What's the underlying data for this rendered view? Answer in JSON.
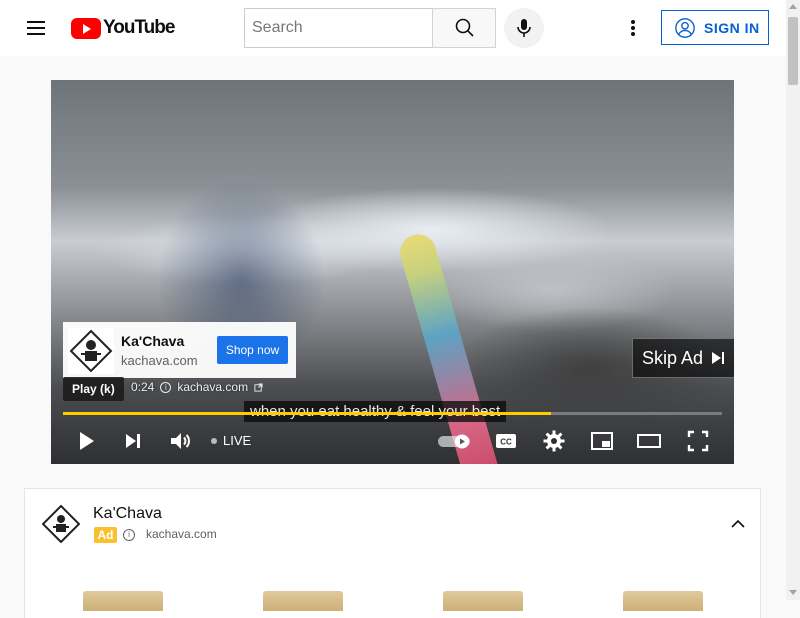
{
  "header": {
    "logo_text": "YouTube",
    "search_placeholder": "Search",
    "sign_in_label": "SIGN IN"
  },
  "player": {
    "ad_card": {
      "advertiser": "Ka'Chava",
      "domain": "kachava.com",
      "cta_label": "Shop now"
    },
    "skip_ad_label": "Skip Ad",
    "tooltip_label": "Play (k)",
    "ad_time": "0:24",
    "ad_domain": "kachava.com",
    "caption_text": "when you eat healthy & feel your best",
    "progress_fraction": 0.74,
    "live_label": "LIVE",
    "progress_color": "#ffcc00"
  },
  "companion": {
    "advertiser": "Ka'Chava",
    "ad_badge": "Ad",
    "domain": "kachava.com"
  },
  "colors": {
    "brand_red": "#ff0000",
    "link_blue": "#065fd4",
    "cta_blue": "#1a73e8",
    "ad_badge_yellow": "#f9c12f"
  }
}
